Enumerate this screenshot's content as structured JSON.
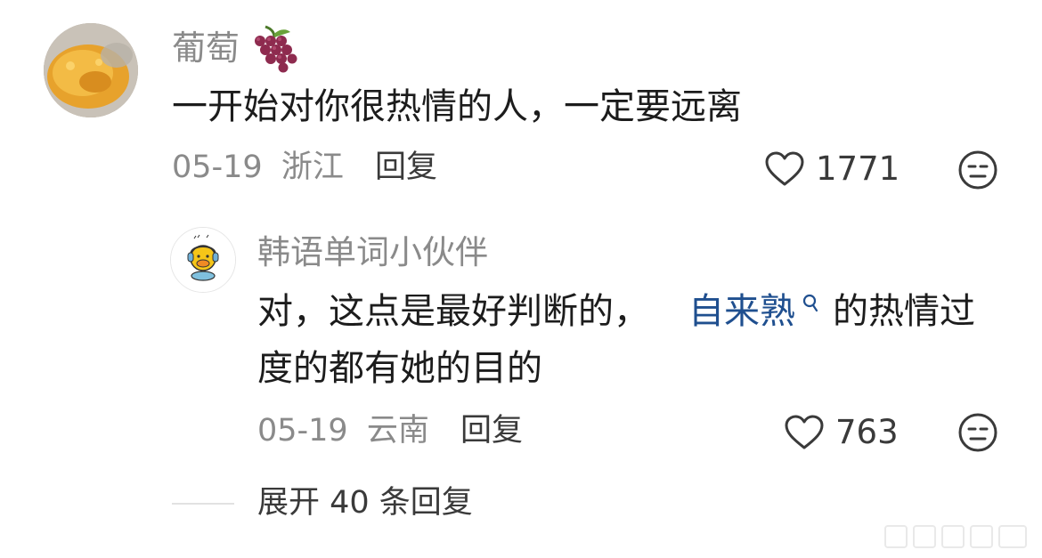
{
  "comment": {
    "author": "葡萄",
    "author_emoji_icon": "grape-icon",
    "text": "一开始对你很热情的人，一定要远离",
    "date": "05-19",
    "location": "浙江",
    "reply_label": "回复",
    "likes": "1771"
  },
  "reply": {
    "author": "韩语单词小伙伴",
    "text_line1_prefix": "对，这点是最好判断的，",
    "link_text": "自来熟",
    "text_line1_suffix": "的热情过",
    "text_line2": "度的都有她的目的",
    "date": "05-19",
    "location": "云南",
    "reply_label": "回复",
    "likes": "763"
  },
  "expand": {
    "label": "展开 40 条回复"
  },
  "colors": {
    "secondary_text": "#8a8a8a",
    "body_text": "#1c1c1c",
    "link": "#1f4f8f"
  }
}
